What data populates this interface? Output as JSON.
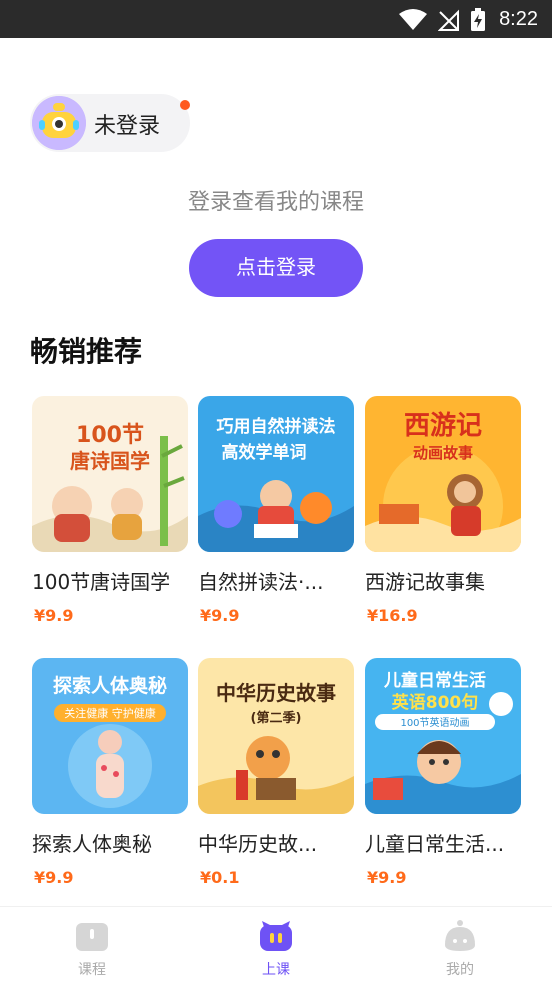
{
  "status_bar": {
    "time": "8:22"
  },
  "user": {
    "name": "未登录"
  },
  "login": {
    "hint": "登录查看我的课程",
    "button_label": "点击登录"
  },
  "section": {
    "title": "畅销推荐"
  },
  "courses": [
    {
      "title": "100节唐诗国学",
      "price": "¥9.9",
      "cover_text": [
        "100节",
        "唐诗国学"
      ]
    },
    {
      "title": "自然拼读法·...",
      "price": "¥9.9",
      "cover_text": [
        "巧用自然拼读法",
        "高效学单词"
      ]
    },
    {
      "title": "西游记故事集",
      "price": "¥16.9",
      "cover_text": [
        "西游记",
        "动画故事"
      ]
    },
    {
      "title": "探索人体奥秘",
      "price": "¥9.9",
      "cover_text": [
        "探索人体奥秘",
        "关注健康 守护健康"
      ]
    },
    {
      "title": "中华历史故...",
      "price": "¥0.1",
      "cover_text": [
        "中华历史故事",
        "(第二季)"
      ]
    },
    {
      "title": "儿童日常生活...",
      "price": "¥9.9",
      "cover_text": [
        "儿童日常生活",
        "英语800句",
        "100节英语动画"
      ]
    }
  ],
  "nav": [
    {
      "label": "课程",
      "icon": "book-icon"
    },
    {
      "label": "上课",
      "icon": "class-icon"
    },
    {
      "label": "我的",
      "icon": "profile-icon"
    }
  ],
  "colors": {
    "accent": "#7354f6",
    "price": "#ff6a1a",
    "nav_active": "#6e52f5"
  }
}
